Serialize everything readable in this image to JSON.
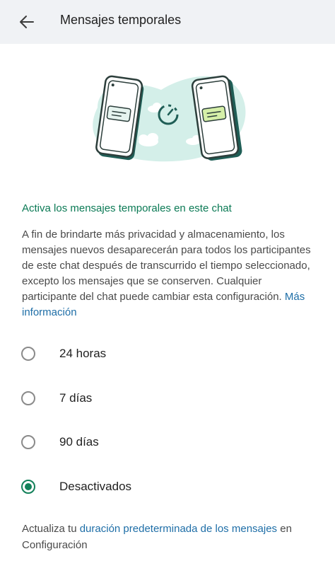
{
  "header": {
    "title": "Mensajes temporales"
  },
  "section": {
    "subtitle": "Activa los mensajes temporales en este chat",
    "description": "A fin de brindarte más privacidad y almacenamiento, los mensajes nuevos desaparecerán para todos los participantes de este chat después de transcurrido el tiempo seleccionado, excepto los mensajes que se conserven. Cualquier participante del chat puede cambiar esta configuración.",
    "more_info_link": "Más información"
  },
  "options": [
    {
      "label": "24 horas",
      "selected": false
    },
    {
      "label": "7 días",
      "selected": false
    },
    {
      "label": "90 días",
      "selected": false
    },
    {
      "label": "Desactivados",
      "selected": true
    }
  ],
  "footer": {
    "prefix": "Actualiza tu ",
    "link": "duración predeterminada de los mensajes",
    "suffix": " en Configuración"
  },
  "colors": {
    "accent": "#13815a",
    "link": "#1e6ea7",
    "header_bg": "#f0f2f5"
  }
}
